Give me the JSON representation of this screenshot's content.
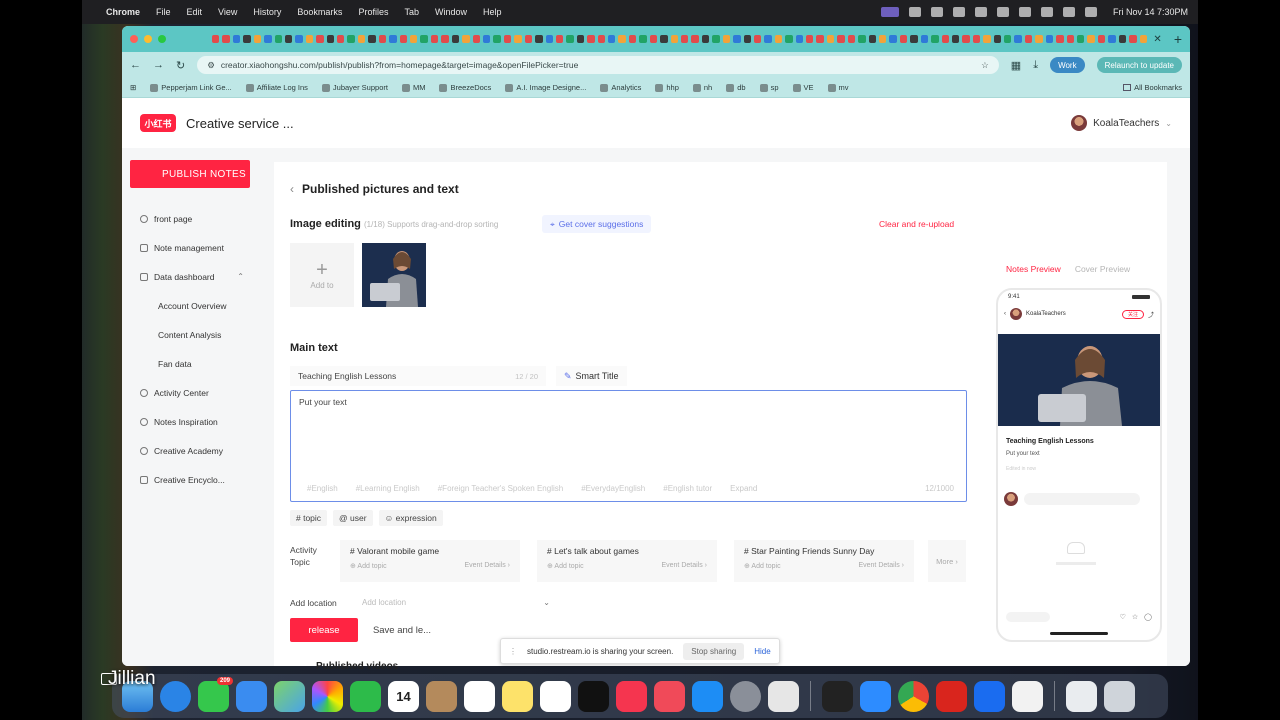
{
  "menubar": {
    "app": "Chrome",
    "menus": [
      "File",
      "Edit",
      "View",
      "History",
      "Bookmarks",
      "Profiles",
      "Tab",
      "Window",
      "Help"
    ],
    "clock": "Fri Nov 14  7:30PM"
  },
  "browser": {
    "url": "creator.xiaohongshu.com/publish/publish?from=homepage&target=image&openFilePicker=true",
    "profile_label": "Work",
    "relaunch_label": "Relaunch to update",
    "bookmarks": [
      "Pepperjam Link Ge...",
      "Affiliate Log Ins",
      "Jubayer Support",
      "MM",
      "BreezeDocs",
      "A.I. Image Designe...",
      "Analytics",
      "hhp",
      "nh",
      "db",
      "sp",
      "VE",
      "mv"
    ],
    "all_bookmarks": "All Bookmarks"
  },
  "header": {
    "logo_text": "小红书",
    "brand": "Creative service ...",
    "username": "KoalaTeachers"
  },
  "sidebar": {
    "publish_label": "PUBLISH NOTES",
    "items": [
      {
        "label": "front page",
        "sub": false
      },
      {
        "label": "Note management",
        "sub": false
      },
      {
        "label": "Data dashboard",
        "sub": false
      },
      {
        "label": "Account Overview",
        "sub": true
      },
      {
        "label": "Content Analysis",
        "sub": true
      },
      {
        "label": "Fan data",
        "sub": true
      },
      {
        "label": "Activity Center",
        "sub": false
      },
      {
        "label": "Notes Inspiration",
        "sub": false
      },
      {
        "label": "Creative Academy",
        "sub": false
      },
      {
        "label": "Creative Encyclo...",
        "sub": false
      }
    ]
  },
  "editor": {
    "page_title": "Published pictures and text",
    "image_editing_label": "Image editing",
    "image_editing_hint": "(1/18)  Supports drag-and-drop sorting",
    "cover_suggestions": "Get cover suggestions",
    "clear_reupload": "Clear and re-upload",
    "add_to": "Add to",
    "main_text_label": "Main text",
    "title_value": "Teaching English Lessons",
    "title_count": "12 / 20",
    "smart_title": "Smart Title",
    "body_placeholder": "Put your text",
    "hashtags": [
      "#English",
      "#Learning English",
      "#Foreign Teacher's Spoken English",
      "#EverydayEnglish",
      "#English tutor",
      "Expand"
    ],
    "body_count": "12/1000",
    "chips": [
      "# topic",
      "@ user",
      "☺ expression"
    ],
    "activity_label": "Activity Topic",
    "activities": [
      {
        "title": "# Valorant mobile game",
        "add": "⊕ Add topic",
        "details": "Event Details ›"
      },
      {
        "title": "# Let's talk about games",
        "add": "⊕ Add topic",
        "details": "Event Details ›"
      },
      {
        "title": "# Star Painting Friends Sunny Day",
        "add": "⊕ Add topic",
        "details": "Event Details ›"
      }
    ],
    "more": "More ›",
    "location_label": "Add location",
    "location_placeholder": "Add location",
    "release": "release",
    "save": "Save and le..."
  },
  "preview": {
    "tab_active": "Notes Preview",
    "tab_inactive": "Cover Preview",
    "time": "9:41",
    "author": "KoalaTeachers",
    "follow": "关注",
    "title": "Teaching English Lessons",
    "text": "Put your text",
    "date": "Edited in now"
  },
  "share_bar": {
    "message": "studio.restream.io is sharing your screen.",
    "stop": "Stop sharing",
    "hide": "Hide"
  },
  "overlay": {
    "presenter": "Jillian",
    "published_videos": "Published videos"
  },
  "dock": {
    "apps": [
      "Finder",
      "Safari",
      "Messages",
      "Mail",
      "Maps",
      "Photos",
      "FaceTime",
      "Calendar",
      "Contacts",
      "Reminders",
      "Notes",
      "Freeform",
      "TV",
      "Music",
      "News",
      "App Store",
      "System Settings",
      "Screen Sharing",
      "Terminal",
      "Zoom",
      "Chrome",
      "Acrobat",
      "Xcode",
      "TextEdit",
      "Downloads",
      "Trash"
    ],
    "calendar_day": "14",
    "messages_badge": "209"
  }
}
